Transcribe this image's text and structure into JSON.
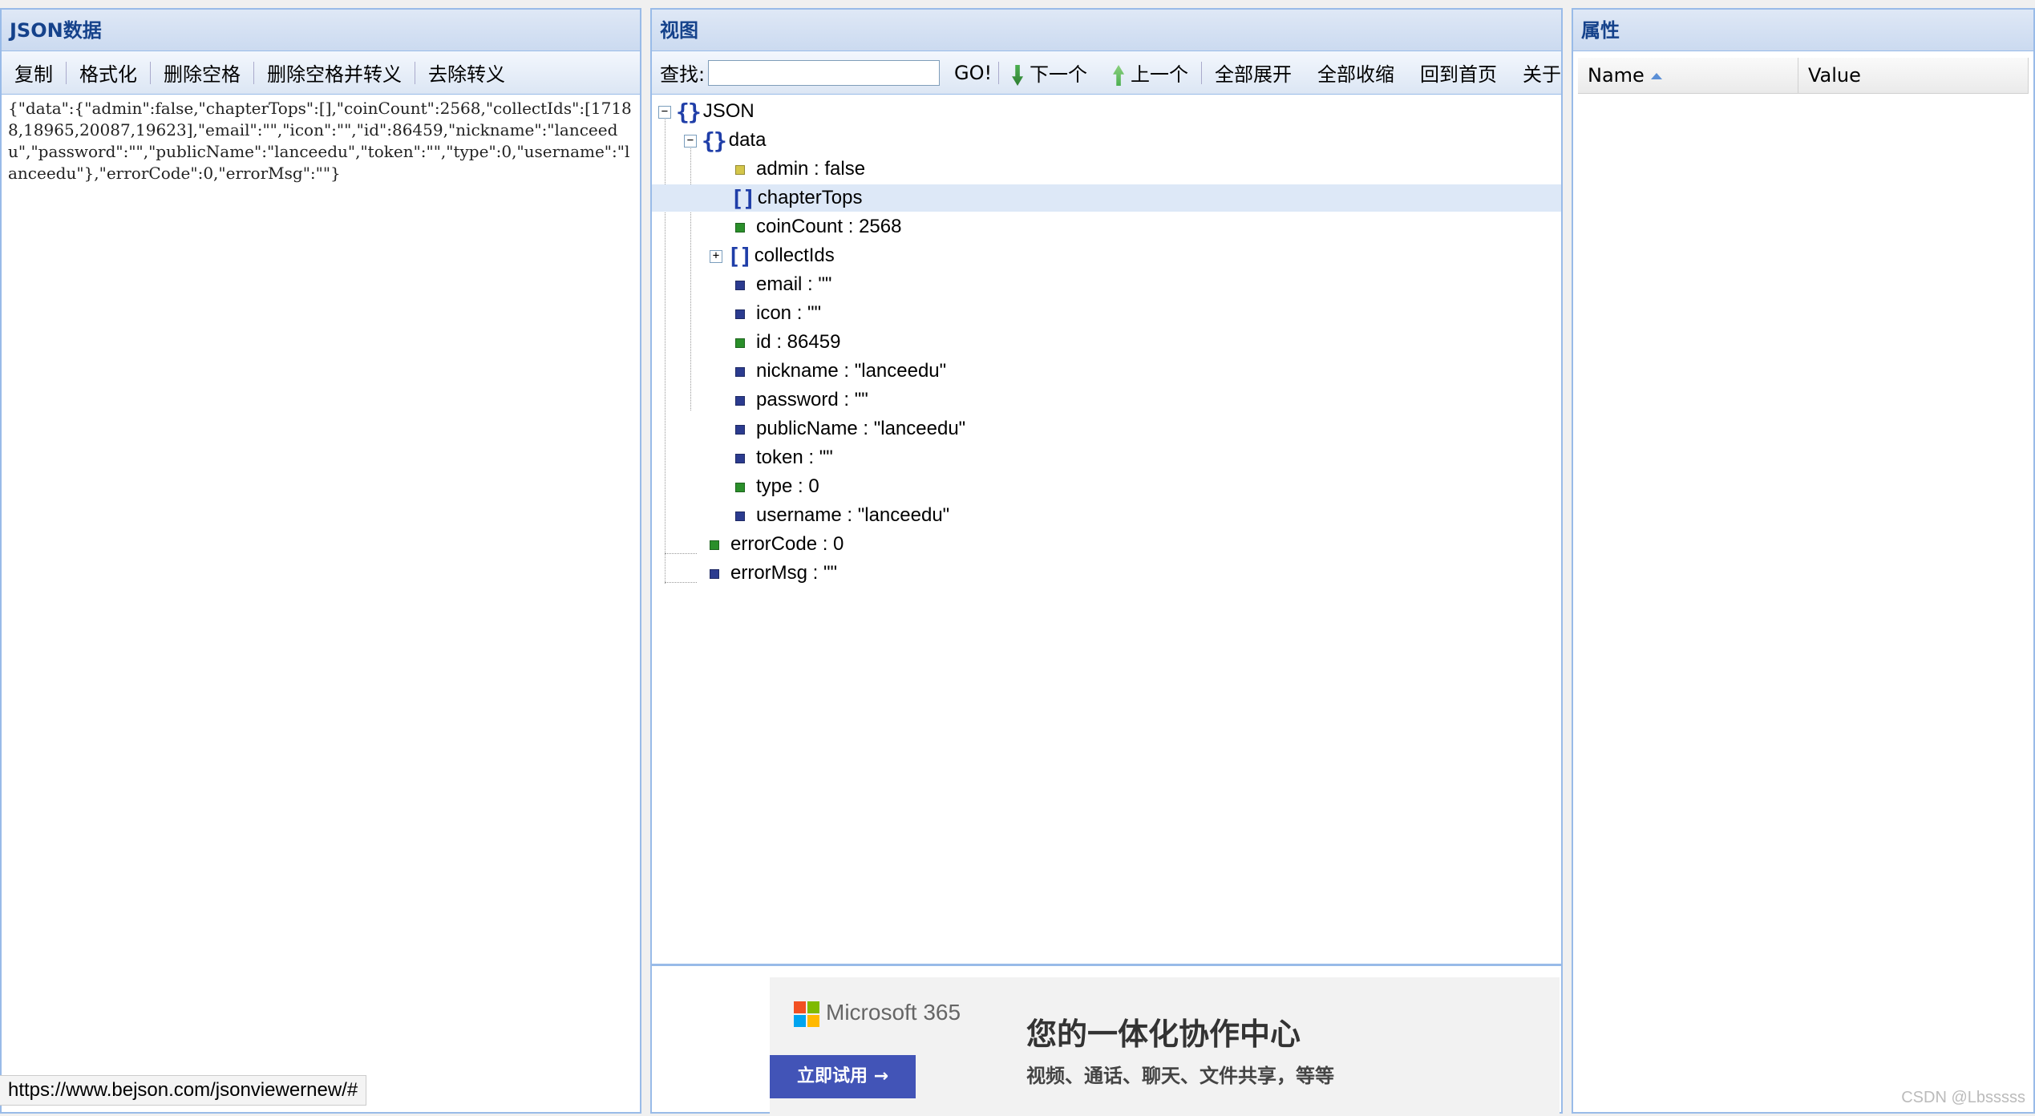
{
  "left": {
    "title": "JSON数据",
    "toolbar": [
      "复制",
      "格式化",
      "删除空格",
      "删除空格并转义",
      "去除转义"
    ],
    "raw_json": "{\"data\":{\"admin\":false,\"chapterTops\":[],\"coinCount\":2568,\"collectIds\":[17188,18965,20087,19623],\"email\":\"\",\"icon\":\"\",\"id\":86459,\"nickname\":\"lanceedu\",\"password\":\"\",\"publicName\":\"lanceedu\",\"token\":\"\",\"type\":0,\"username\":\"lanceedu\"},\"errorCode\":0,\"errorMsg\":\"\"}"
  },
  "middle": {
    "title": "视图",
    "search_label": "查找:",
    "go_label": "GO!",
    "next_label": "下一个",
    "prev_label": "上一个",
    "expand_all": "全部展开",
    "collapse_all": "全部收缩",
    "home": "回到首页",
    "about": "关于",
    "tree": {
      "root": "JSON",
      "data": "data",
      "admin": "admin : false",
      "chapterTops": "chapterTops",
      "coinCount": "coinCount : 2568",
      "collectIds": "collectIds",
      "email": "email : \"\"",
      "icon": "icon : \"\"",
      "id": "id : 86459",
      "nickname": "nickname : \"lanceedu\"",
      "password": "password : \"\"",
      "publicName": "publicName : \"lanceedu\"",
      "token": "token : \"\"",
      "type": "type : 0",
      "username": "username : \"lanceedu\"",
      "errorCode": "errorCode : 0",
      "errorMsg": "errorMsg : \"\""
    },
    "ad": {
      "brand": "Microsoft 365",
      "cta": "立即试用 →",
      "headline": "您的一体化协作中心",
      "subline": "视频、通话、聊天、文件共享，等等"
    }
  },
  "right": {
    "title": "属性",
    "col_name": "Name",
    "col_value": "Value"
  },
  "status_url": "https://www.bejson.com/jsonviewernew/#",
  "watermark": "CSDN @Lbsssss",
  "colors": {
    "panel_border": "#99bbe8",
    "title_text": "#15428b",
    "bool_leaf": "#d4c64a",
    "number_leaf": "#2a8f2a",
    "string_leaf": "#2b3b8f",
    "selected_row": "#dde8f7",
    "ad_button": "#4254b7"
  },
  "icons": {
    "object": "curly-braces-icon",
    "array": "square-brackets-icon",
    "collapse": "minus-box-icon",
    "expand": "plus-box-icon",
    "next": "green-down-arrow-icon",
    "prev": "green-up-arrow-icon"
  }
}
